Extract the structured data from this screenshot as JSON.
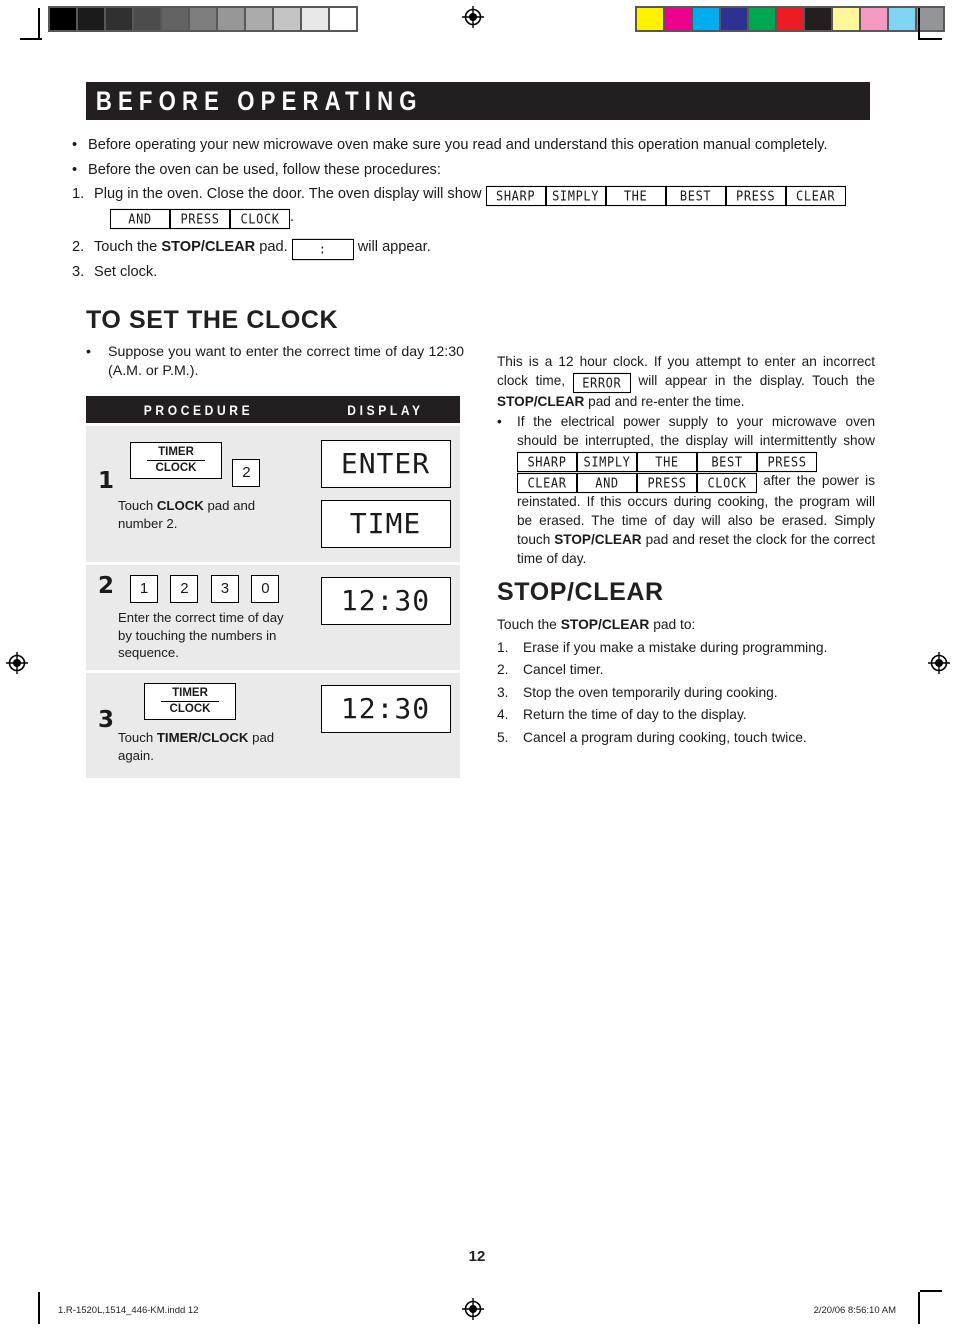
{
  "calibration": {
    "gray_wedge": [
      "#000000",
      "#1b1b1b",
      "#303030",
      "#4c4c4c",
      "#636363",
      "#7d7d7d",
      "#969696",
      "#ababab",
      "#c4c4c4",
      "#e8e8e8",
      "#ffffff"
    ],
    "color_bar": [
      "#fff200",
      "#ec008c",
      "#00aeef",
      "#2e3192",
      "#00a651",
      "#ed1c24",
      "#231f20",
      "#fff799",
      "#f49ac1",
      "#80d3f2",
      "#939598"
    ]
  },
  "banner": {
    "title": "BEFORE OPERATING"
  },
  "intro": {
    "bullet1": "Before operating your new microwave oven make sure you read and understand this operation manual completely.",
    "bullet2": "Before the oven can be used, follow these procedures:",
    "step1_num": "1.",
    "step1_text": "Plug in the oven. Close the door. The oven display will show",
    "step1_lcds_line1": [
      "SHARP",
      "SIMPLY",
      "THE",
      "BEST",
      "PRESS",
      "CLEAR"
    ],
    "step1_lcds_line2": [
      "AND",
      "PRESS",
      "CLOCK"
    ],
    "step1_period": ".",
    "step2_num": "2.",
    "step2_pre": "Touch the",
    "step2_bold": "STOP/CLEAR",
    "step2_mid": "pad.",
    "step2_lcd": ":",
    "step2_post": "will appear.",
    "step3_num": "3.",
    "step3_text": "Set clock."
  },
  "clock_section": {
    "title": "TO SET THE CLOCK",
    "bullet": "•",
    "suppose": "Suppose you want to enter the correct time of day 12:30 (A.M. or P.M.).",
    "table": {
      "header_procedure": "PROCEDURE",
      "header_display": "DISPLAY",
      "rows": [
        {
          "number": "1",
          "pad_timer": "TIMER",
          "pad_clock": "CLOCK",
          "pad_number": "2",
          "desc_pre": "Touch",
          "desc_bold": "CLOCK",
          "desc_post": "pad and number 2.",
          "displays": [
            "ENTER",
            "TIME"
          ]
        },
        {
          "number": "2",
          "pads": [
            "1",
            "2",
            "3",
            "0"
          ],
          "desc": "Enter the correct time of  day by touching the numbers in sequence.",
          "displays": [
            "12:30"
          ]
        },
        {
          "number": "3",
          "pad_timer": "TIMER",
          "pad_clock": "CLOCK",
          "desc_pre": "Touch",
          "desc_bold": "TIMER/CLOCK",
          "desc_post": "pad again.",
          "displays": [
            "12:30"
          ]
        }
      ]
    }
  },
  "right_column": {
    "para1_a": "This is a 12 hour clock. If you attempt to enter an incorrect clock time,",
    "para1_lcd": "ERROR",
    "para1_b": "will appear in the display. Touch the",
    "para1_bold": "STOP/CLEAR",
    "para1_c": "pad and re-enter the time.",
    "bullet_mark": "•",
    "para2_a": "If the electrical power supply to your microwave oven should be interrupted, the display will intermittently show",
    "para2_lcds": [
      "SHARP",
      "SIMPLY",
      "THE",
      "BEST",
      "PRESS",
      "CLEAR",
      "AND",
      "PRESS",
      "CLOCK"
    ],
    "para2_b": "after the power is reinstated. If this occurs during cooking, the program will be erased. The time of day will also be erased. Simply touch",
    "para2_bold": "STOP/CLEAR",
    "para2_c": "pad and reset the clock for the correct time of day."
  },
  "stopclear": {
    "title": "STOP/CLEAR",
    "intro_pre": "Touch the",
    "intro_bold": "STOP/CLEAR",
    "intro_post": "pad to:",
    "items": [
      {
        "n": "1.",
        "text": "Erase if you make a mistake during programming."
      },
      {
        "n": "2.",
        "text": "Cancel timer."
      },
      {
        "n": "3.",
        "text": "Stop the oven temporarily during cooking."
      },
      {
        "n": "4.",
        "text": "Return the time of day to the display."
      },
      {
        "n": "5.",
        "text": "Cancel a program during cooking, touch twice."
      }
    ]
  },
  "page_number": "12",
  "footer": {
    "left": "1.R-1520L,1514_446-KM.indd   12",
    "right": "2/20/06   8:56:10 AM"
  }
}
